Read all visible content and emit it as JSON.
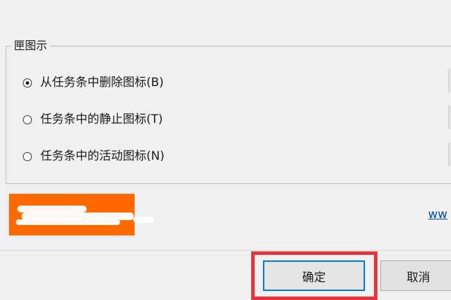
{
  "group": {
    "title": "匣图示",
    "options": [
      {
        "label": "从任务条中删除图标(B)",
        "selected": true
      },
      {
        "label": "任务条中的静止图标(T)",
        "selected": false
      },
      {
        "label": "任务条中的活动图标(N)",
        "selected": false
      }
    ]
  },
  "link": {
    "text": "ww"
  },
  "buttons": {
    "ok_label": "确定",
    "cancel_label": "取消"
  },
  "colors": {
    "logo_bg": "#ff6a00",
    "highlight": "#e8323c",
    "focus_border": "#0078d7",
    "link": "#0645ad"
  }
}
